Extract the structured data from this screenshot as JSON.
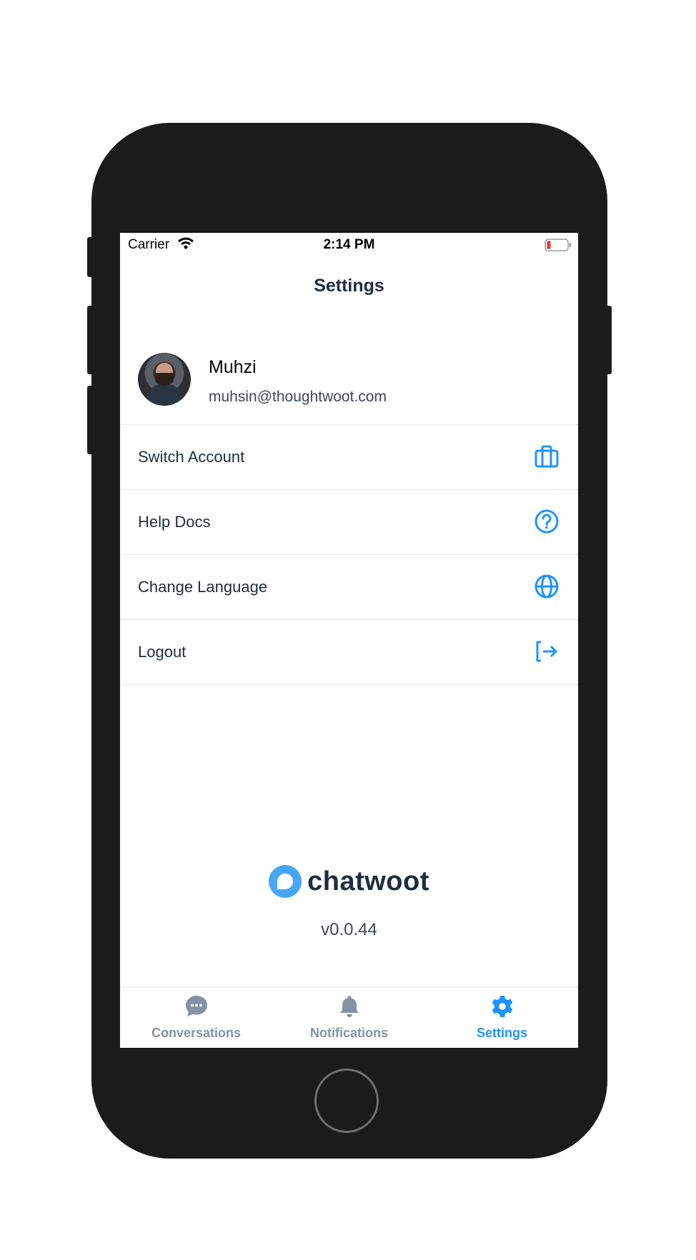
{
  "status_bar": {
    "carrier": "Carrier",
    "time": "2:14 PM"
  },
  "header": {
    "title": "Settings"
  },
  "profile": {
    "name": "Muhzi",
    "email": "muhsin@thoughtwoot.com"
  },
  "menu": {
    "items": [
      {
        "label": "Switch Account",
        "icon": "briefcase-icon"
      },
      {
        "label": "Help Docs",
        "icon": "help-circle-icon"
      },
      {
        "label": "Change Language",
        "icon": "globe-icon"
      },
      {
        "label": "Logout",
        "icon": "logout-icon"
      }
    ]
  },
  "branding": {
    "name": "chatwoot",
    "version": "v0.0.44"
  },
  "tabs": [
    {
      "label": "Conversations",
      "icon": "chat-bubble-icon",
      "active": false
    },
    {
      "label": "Notifications",
      "icon": "bell-icon",
      "active": false
    },
    {
      "label": "Settings",
      "icon": "gear-icon",
      "active": true
    }
  ],
  "colors": {
    "accent": "#1f93ff",
    "text": "#1f2d3d",
    "muted": "#8492a6",
    "frame": "#1b1b1b"
  }
}
